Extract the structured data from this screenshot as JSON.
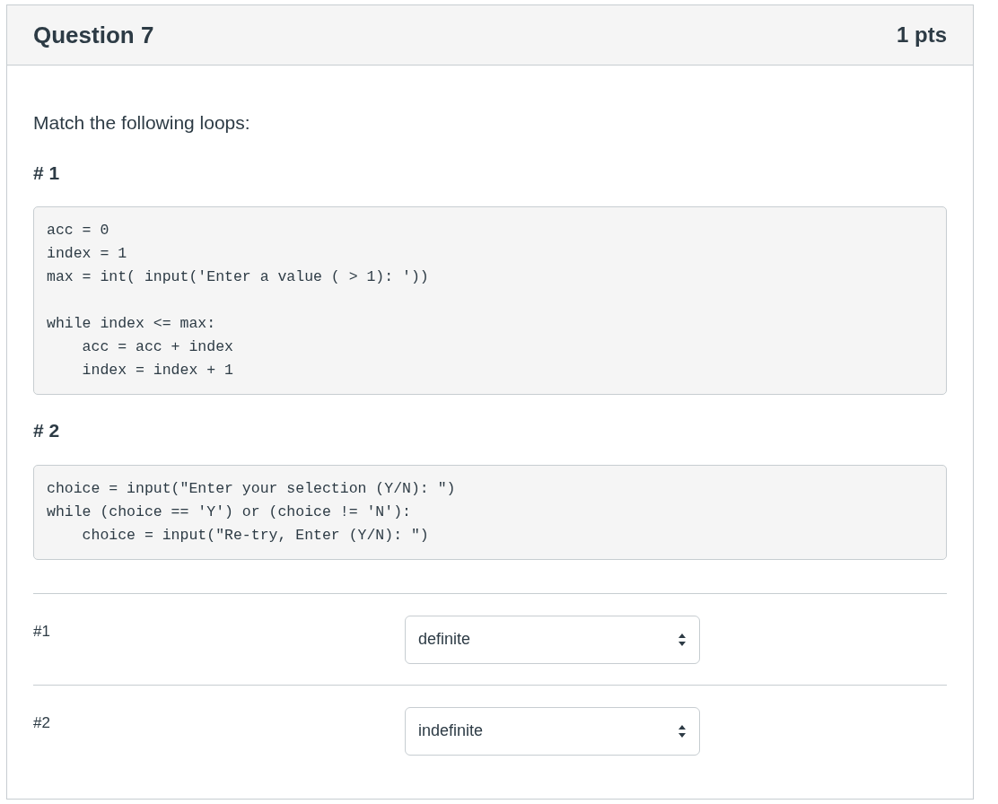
{
  "question": {
    "title": "Question 7",
    "points": "1 pts"
  },
  "prompt": "Match the following loops:",
  "snippets": [
    {
      "heading": "# 1",
      "code": "acc = 0\nindex = 1\nmax = int( input('Enter a value ( > 1): '))\n\nwhile index <= max:\n    acc = acc + index\n    index = index + 1"
    },
    {
      "heading": "# 2",
      "code": "choice = input(\"Enter your selection (Y/N): \")\nwhile (choice == 'Y') or (choice != 'N'):\n    choice = input(\"Re-try, Enter (Y/N): \")"
    }
  ],
  "matches": [
    {
      "label": "#1",
      "value": "definite"
    },
    {
      "label": "#2",
      "value": "indefinite"
    }
  ]
}
